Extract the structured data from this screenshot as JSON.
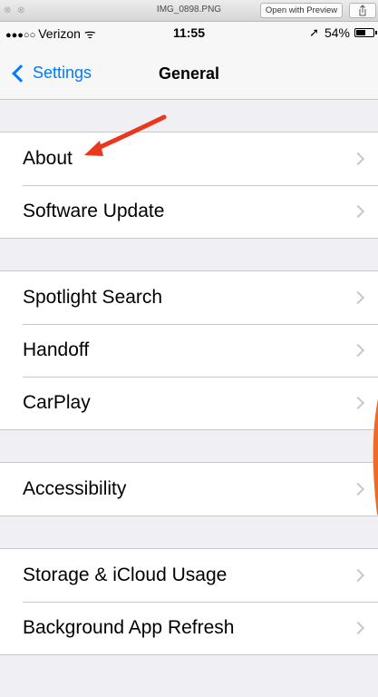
{
  "quicklook": {
    "filename": "IMG_0898.PNG",
    "open_with_label": "Open with Preview"
  },
  "status_bar": {
    "signal": "●●●○○",
    "carrier": "Verizon",
    "wifi_glyph": "ᯤ",
    "time": "11:55",
    "location_glyph": "➚",
    "battery": "54%",
    "battery_level": 0.54
  },
  "nav": {
    "back_label": "Settings",
    "title": "General"
  },
  "groups": [
    {
      "rows": [
        {
          "label": "About"
        },
        {
          "label": "Software Update"
        }
      ]
    },
    {
      "rows": [
        {
          "label": "Spotlight Search"
        },
        {
          "label": "Handoff"
        },
        {
          "label": "CarPlay"
        }
      ]
    },
    {
      "rows": [
        {
          "label": "Accessibility"
        }
      ]
    },
    {
      "rows": [
        {
          "label": "Storage & iCloud Usage"
        },
        {
          "label": "Background App Refresh"
        }
      ]
    }
  ],
  "colors": {
    "ios_blue": "#007aff",
    "annotation_red": "#e8391f",
    "annotation_orange": "#ee6a2a",
    "group_background": "#efeff4"
  }
}
